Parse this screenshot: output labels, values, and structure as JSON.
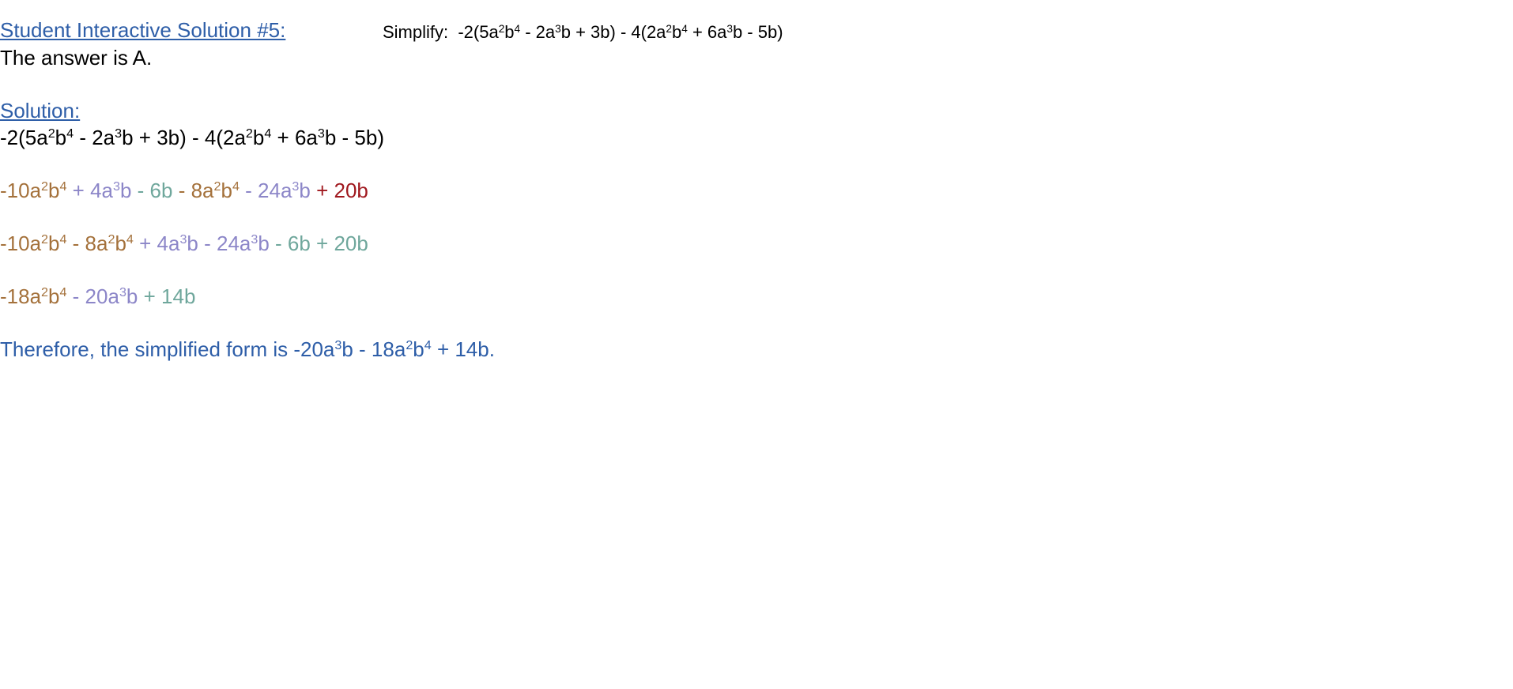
{
  "header": {
    "title": "Student Interactive Solution #5:",
    "prompt_label": "Simplify:",
    "problem": [
      {
        "t": "-2(5a"
      },
      {
        "s": "2"
      },
      {
        "t": "b"
      },
      {
        "s": "4"
      },
      {
        "t": " - 2a"
      },
      {
        "s": "3"
      },
      {
        "t": "b + 3b) - 4(2a"
      },
      {
        "s": "2"
      },
      {
        "t": "b"
      },
      {
        "s": "4"
      },
      {
        "t": " + 6a"
      },
      {
        "s": "3"
      },
      {
        "t": "b - 5b)"
      }
    ]
  },
  "answer": "The answer is A.",
  "solution_heading": "Solution:",
  "colors": {
    "link": "#2e5ea8",
    "a2b4_terms": "#a4713b",
    "a3b_terms": "#8c86c8",
    "b_terms": "#6fa79c",
    "highlight_term": "#a0191f",
    "conclusion": "#2e5ea8"
  },
  "steps": [
    {
      "segments": [
        {
          "c": "black",
          "parts": [
            {
              "t": "-2(5a"
            },
            {
              "s": "2"
            },
            {
              "t": "b"
            },
            {
              "s": "4"
            },
            {
              "t": " - 2a"
            },
            {
              "s": "3"
            },
            {
              "t": "b + 3b) - 4(2a"
            },
            {
              "s": "2"
            },
            {
              "t": "b"
            },
            {
              "s": "4"
            },
            {
              "t": " + 6a"
            },
            {
              "s": "3"
            },
            {
              "t": "b - 5b)"
            }
          ]
        }
      ]
    },
    {
      "segments": [
        {
          "c": "brown",
          "parts": [
            {
              "t": "-10a"
            },
            {
              "s": "2"
            },
            {
              "t": "b"
            },
            {
              "s": "4"
            }
          ]
        },
        {
          "c": "purple",
          "parts": [
            {
              "t": " + 4a"
            },
            {
              "s": "3"
            },
            {
              "t": "b"
            }
          ]
        },
        {
          "c": "teal",
          "parts": [
            {
              "t": " - 6b"
            }
          ]
        },
        {
          "c": "brown",
          "parts": [
            {
              "t": " - 8a"
            },
            {
              "s": "2"
            },
            {
              "t": "b"
            },
            {
              "s": "4"
            }
          ]
        },
        {
          "c": "purple",
          "parts": [
            {
              "t": " - 24a"
            },
            {
              "s": "3"
            },
            {
              "t": "b"
            }
          ]
        },
        {
          "c": "red",
          "parts": [
            {
              "t": " + 20b"
            }
          ]
        }
      ]
    },
    {
      "segments": [
        {
          "c": "brown",
          "parts": [
            {
              "t": "-10a"
            },
            {
              "s": "2"
            },
            {
              "t": "b"
            },
            {
              "s": "4"
            },
            {
              "t": " - 8a"
            },
            {
              "s": "2"
            },
            {
              "t": "b"
            },
            {
              "s": "4"
            }
          ]
        },
        {
          "c": "purple",
          "parts": [
            {
              "t": " + 4a"
            },
            {
              "s": "3"
            },
            {
              "t": "b - 24a"
            },
            {
              "s": "3"
            },
            {
              "t": "b"
            }
          ]
        },
        {
          "c": "teal",
          "parts": [
            {
              "t": " - 6b + 20b"
            }
          ]
        }
      ]
    },
    {
      "segments": [
        {
          "c": "brown",
          "parts": [
            {
              "t": "-18a"
            },
            {
              "s": "2"
            },
            {
              "t": "b"
            },
            {
              "s": "4"
            }
          ]
        },
        {
          "c": "purple",
          "parts": [
            {
              "t": " - 20a"
            },
            {
              "s": "3"
            },
            {
              "t": "b"
            }
          ]
        },
        {
          "c": "teal",
          "parts": [
            {
              "t": " + 14b"
            }
          ]
        }
      ]
    }
  ],
  "conclusion": [
    {
      "t": "Therefore, the simplified form is -20a"
    },
    {
      "s": "3"
    },
    {
      "t": "b - 18a"
    },
    {
      "s": "2"
    },
    {
      "t": "b"
    },
    {
      "s": "4"
    },
    {
      "t": " + 14b."
    }
  ]
}
